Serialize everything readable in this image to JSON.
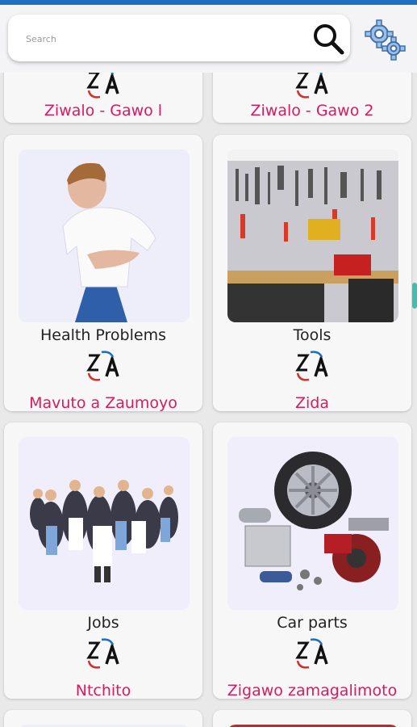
{
  "search": {
    "placeholder": "Search",
    "value": ""
  },
  "cards": [
    {
      "english": "",
      "chichewa": "Ziwalo - Gawo l"
    },
    {
      "english": "",
      "chichewa": "Ziwalo - Gawo 2"
    },
    {
      "english": "Health Problems",
      "chichewa": "Mavuto a Zaumoyo"
    },
    {
      "english": "Tools",
      "chichewa": "Zida"
    },
    {
      "english": "Jobs",
      "chichewa": "Ntchito"
    },
    {
      "english": "Car parts",
      "chichewa": "Zigawo zamagalimoto"
    }
  ],
  "colors": {
    "accent": "#d81b60",
    "status_bar": "#1e6fc0",
    "scroll": "#3fbfb0"
  },
  "icons": [
    "search-icon",
    "settings-gears-icon",
    "translate-icon"
  ]
}
